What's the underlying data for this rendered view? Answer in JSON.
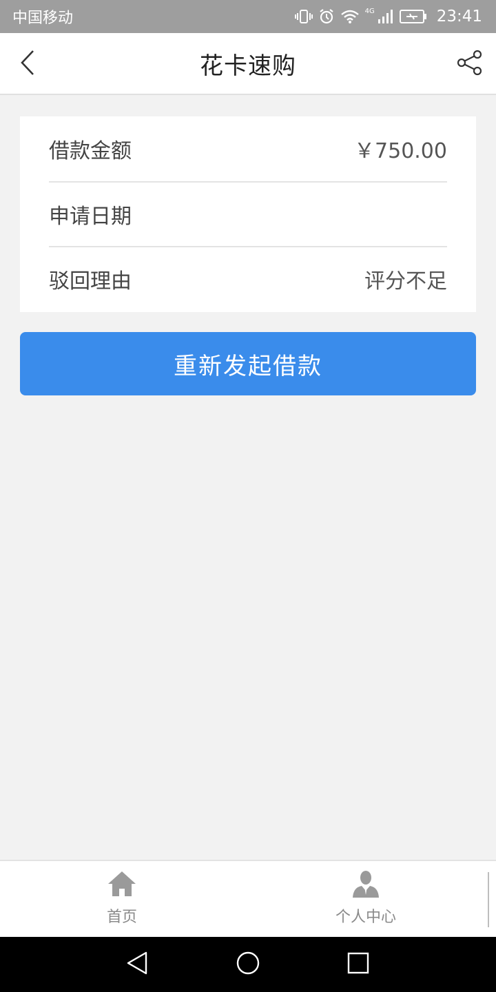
{
  "status_bar": {
    "carrier": "中国移动",
    "network": "4G",
    "time": "23:41",
    "icons": [
      "vibrate-icon",
      "alarm-icon",
      "wifi-icon",
      "signal-icon",
      "battery-charging-icon"
    ]
  },
  "header": {
    "title": "花卡速购",
    "back_icon": "chevron-left-icon",
    "share_icon": "share-icon"
  },
  "loan_info": {
    "amount_label": "借款金额",
    "amount_value": "￥750.00",
    "date_label": "申请日期",
    "date_value": "",
    "reason_label": "驳回理由",
    "reason_value": "评分不足"
  },
  "actions": {
    "relaunch_label": "重新发起借款"
  },
  "tab_bar": {
    "home_label": "首页",
    "home_icon": "home-icon",
    "profile_label": "个人中心",
    "profile_icon": "user-icon"
  },
  "nav_bar": {
    "icons": [
      "nav-back-icon",
      "nav-home-icon",
      "nav-recent-icon"
    ]
  },
  "colors": {
    "primary": "#3a8ceb",
    "status_bar": "#9e9e9e",
    "background": "#f2f2f2",
    "tab_inactive": "#8a8a8a"
  }
}
